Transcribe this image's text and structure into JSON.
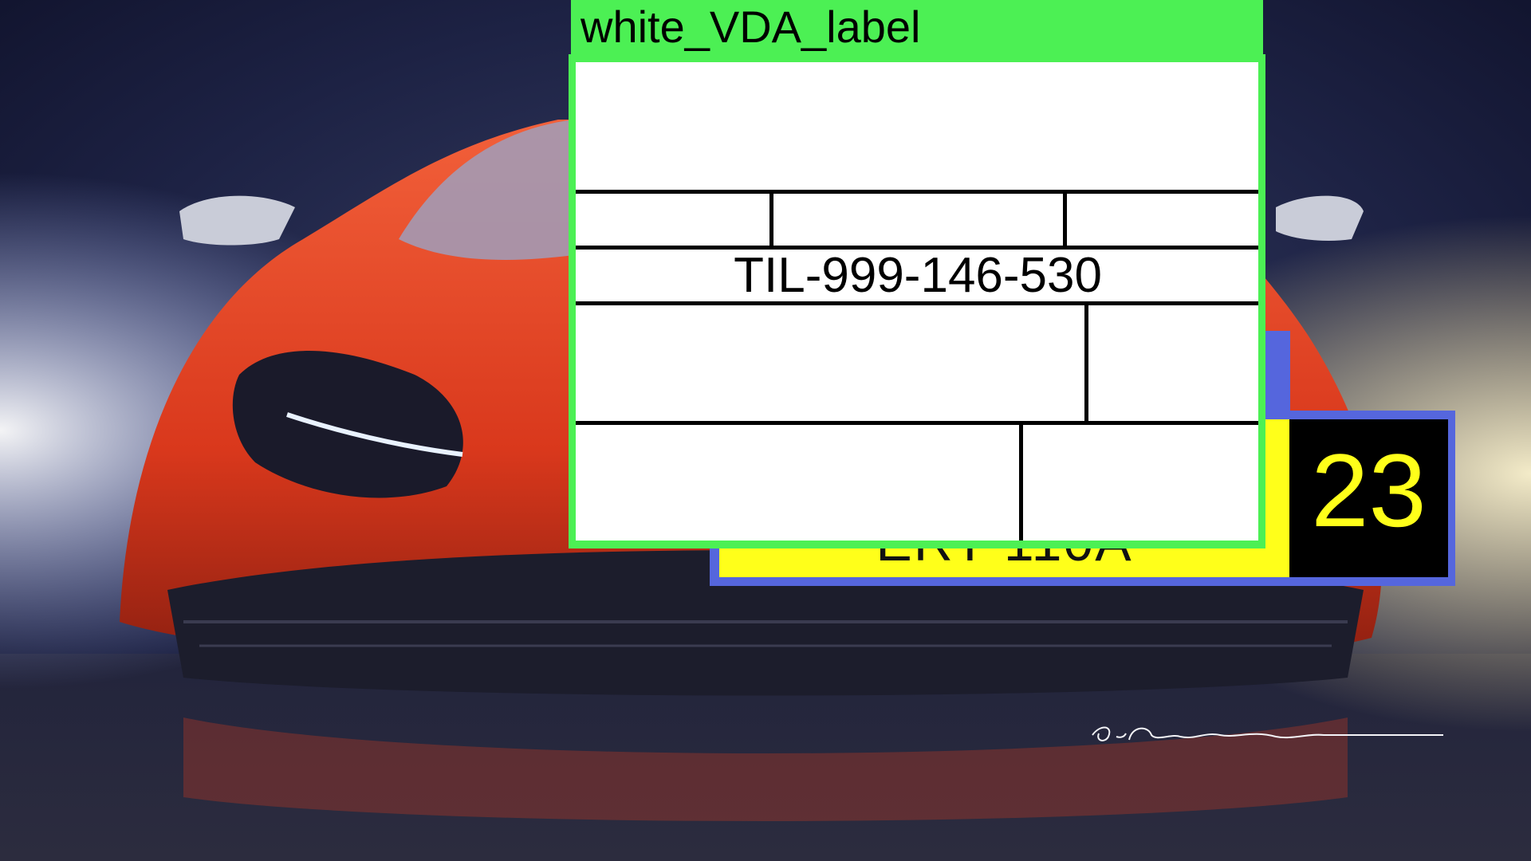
{
  "background": {
    "subject": "sports car sketch",
    "colors": {
      "sky": "#1a1f3a",
      "car_body": "#e0401c",
      "glow": "#fff6d0"
    }
  },
  "white_label": {
    "title": "white_VDA_label",
    "code": "TIL-999-146-530",
    "frame_color": "#4cf054"
  },
  "plate": {
    "text": "ERT 110A",
    "number": "23",
    "frame_color": "#5566dd",
    "plate_color": "#ffff1a"
  },
  "signature": "G.Cilvebasa"
}
